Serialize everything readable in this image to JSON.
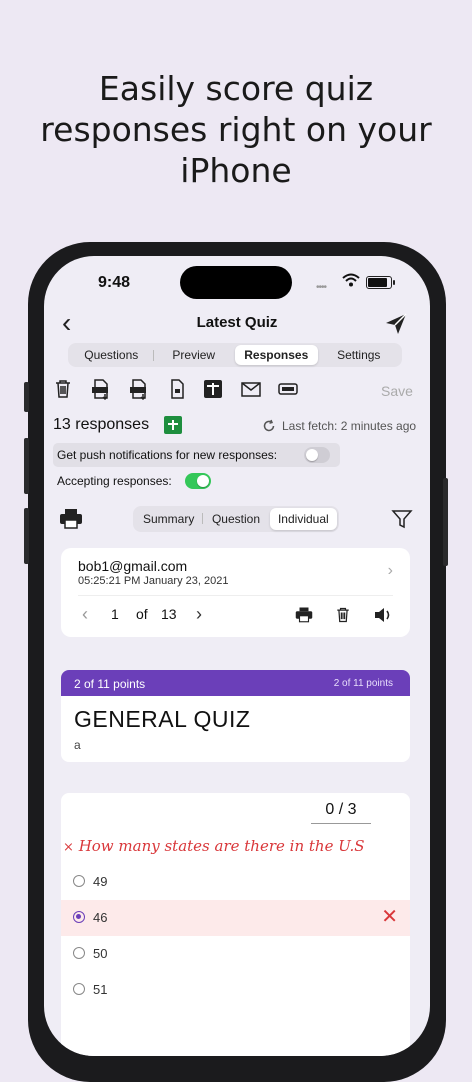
{
  "headline": [
    "Easily score quiz",
    "responses right on your",
    "iPhone"
  ],
  "status": {
    "time": "9:48"
  },
  "nav": {
    "title": "Latest Quiz"
  },
  "tabs": [
    "Questions",
    "Preview",
    "Responses",
    "Settings"
  ],
  "toolbar": {
    "save_label": "Save"
  },
  "responses": {
    "count_label": "13 responses",
    "last_fetch": "Last fetch: 2 minutes ago",
    "push_label": "Get push notifications for new responses:",
    "push_enabled": false,
    "accepting_label": "Accepting responses:",
    "accepting_enabled": true
  },
  "view_tabs": [
    "Summary",
    "Question",
    "Individual"
  ],
  "respondent": {
    "email": "bob1@gmail.com",
    "timestamp": "05:25:21 PM  January 23, 2021",
    "page_current": "1",
    "page_of": "of",
    "page_total": "13"
  },
  "quiz": {
    "points_left": "2 of 11 points",
    "points_right": "2 of 11 points",
    "title": "GENERAL QUIZ",
    "subtitle": "a"
  },
  "question": {
    "score": "0 / 3",
    "text": "How many states are there in the U.S",
    "options": [
      "49",
      "46",
      "50",
      "51"
    ],
    "selected_index": 1
  },
  "colors": {
    "accent": "#6b3fb9",
    "wrong": "#d9373a",
    "toggle_on": "#34c759"
  }
}
